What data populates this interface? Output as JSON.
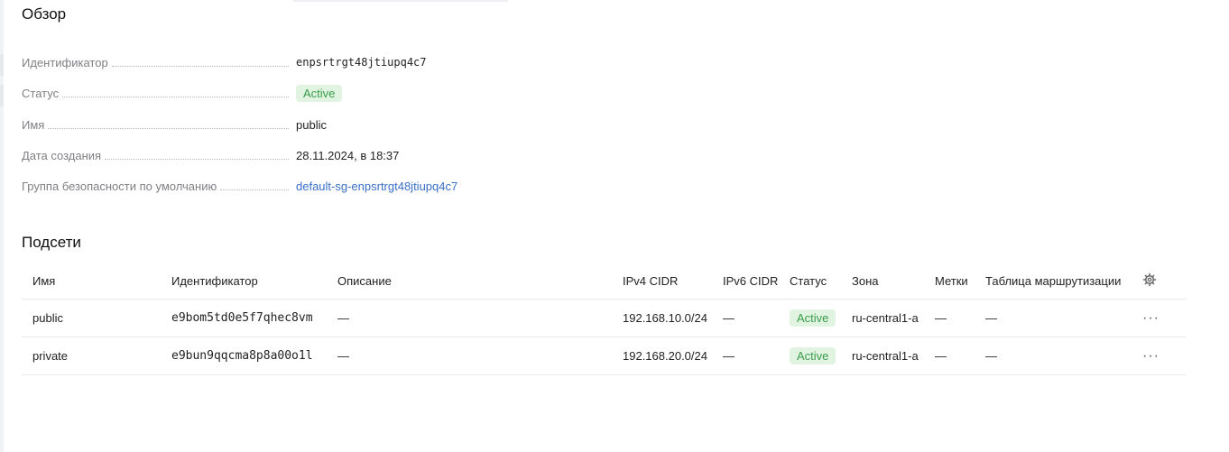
{
  "overview": {
    "title": "Обзор",
    "fields": [
      {
        "label": "Идентификатор",
        "value": "enpsrtrgt48jtiupq4c7"
      },
      {
        "label": "Статус",
        "value": "Active"
      },
      {
        "label": "Имя",
        "value": "public"
      },
      {
        "label": "Дата создания",
        "value": "28.11.2024, в 18:37"
      },
      {
        "label": "Группа безопасности по умолчанию",
        "value": "default-sg-enpsrtrgt48jtiupq4c7"
      }
    ]
  },
  "subnets": {
    "title": "Подсети",
    "columns": [
      "Имя",
      "Идентификатор",
      "Описание",
      "IPv4 CIDR",
      "IPv6 CIDR",
      "Статус",
      "Зона",
      "Метки",
      "Таблица маршрутизации"
    ],
    "rows": [
      {
        "name": "public",
        "id": "e9bom5td0e5f7qhec8vm",
        "description": "—",
        "ipv4": "192.168.10.0/24",
        "ipv6": "—",
        "status": "Active",
        "zone": "ru-central1-a",
        "labels": "—",
        "route_table": "—",
        "actions": "···"
      },
      {
        "name": "private",
        "id": "e9bun9qqcma8p8a00o1l",
        "description": "—",
        "ipv4": "192.168.20.0/24",
        "ipv6": "—",
        "status": "Active",
        "zone": "ru-central1-a",
        "labels": "—",
        "route_table": "—",
        "actions": "···"
      }
    ]
  },
  "colors": {
    "accent_link": "#3a6fc7",
    "status_bg": "#e1f4e2",
    "status_text": "#3a9c49"
  },
  "icons": {
    "settings": "gear-icon",
    "row_menu": "ellipsis-icon"
  }
}
